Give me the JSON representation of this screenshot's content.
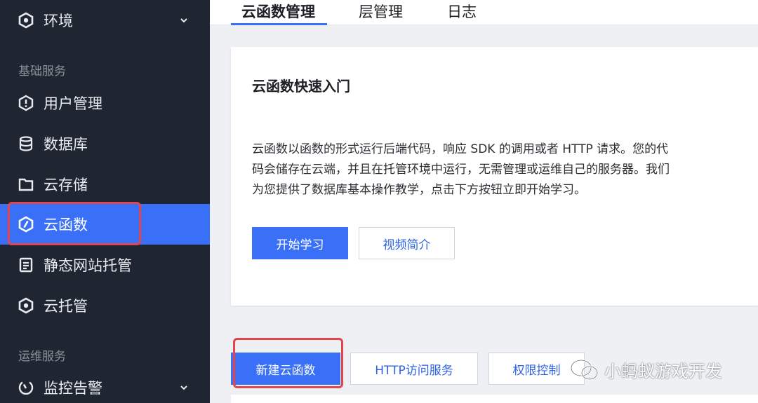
{
  "sidebar": {
    "env": {
      "label": "环境",
      "icon": "hexagon-icon"
    },
    "groups": [
      "基础服务",
      "运维服务"
    ],
    "items": [
      {
        "label": "用户管理",
        "icon": "user-shield-icon"
      },
      {
        "label": "数据库",
        "icon": "database-icon"
      },
      {
        "label": "云存储",
        "icon": "folder-icon"
      },
      {
        "label": "云函数",
        "icon": "function-icon",
        "active": true
      },
      {
        "label": "静态网站托管",
        "icon": "document-icon"
      },
      {
        "label": "云托管",
        "icon": "hexagon-icon"
      }
    ],
    "monitor": {
      "label": "监控告警",
      "icon": "gauge-icon"
    }
  },
  "tabs": [
    {
      "label": "云函数管理",
      "active": true
    },
    {
      "label": "层管理"
    },
    {
      "label": "日志"
    }
  ],
  "card": {
    "title": "云函数快速入门",
    "description": "云函数以函数的形式运行后端代码，响应 SDK 的调用或者 HTTP 请求。您的代码会储存在云端，并且在托管环境中运行，无需管理或运维自己的服务器。我们为您提供了数据库基本操作教学，点击下方按钮立即开始学习。",
    "start_button": "开始学习",
    "video_button": "视频简介"
  },
  "actions": {
    "new_function": "新建云函数",
    "http_service": "HTTP访问服务",
    "permission": "权限控制"
  },
  "watermark": "小蚂蚁游戏开发",
  "colors": {
    "sidebar_bg": "#1f2631",
    "accent": "#3a6ff7",
    "highlight": "#e0464b"
  }
}
